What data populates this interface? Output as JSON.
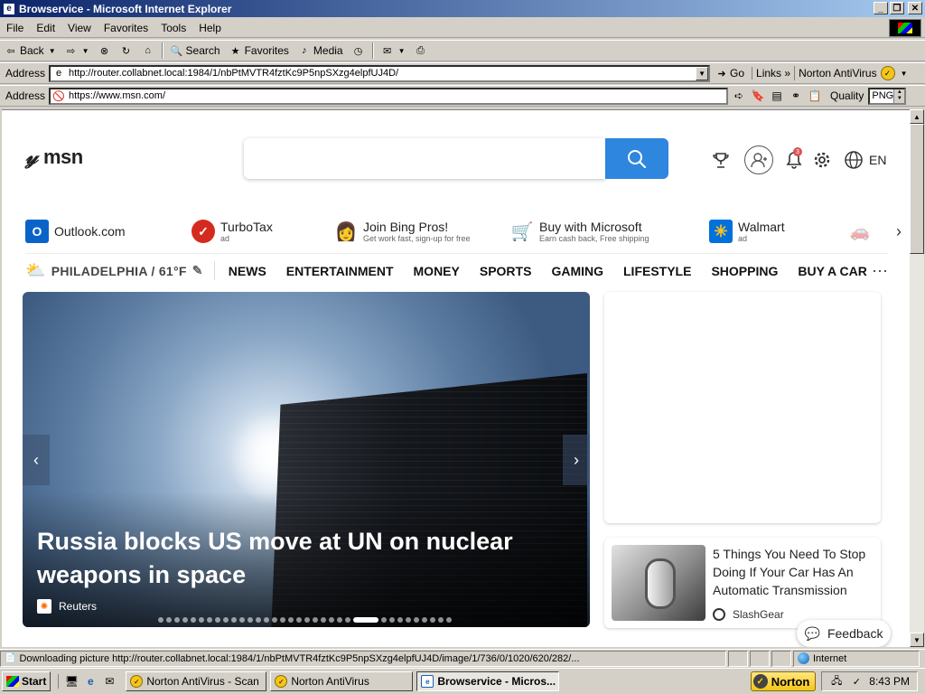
{
  "window": {
    "title": "Browservice - Microsoft Internet Explorer"
  },
  "menubar": {
    "items": [
      "File",
      "Edit",
      "View",
      "Favorites",
      "Tools",
      "Help"
    ]
  },
  "toolbar": {
    "back_label": "Back",
    "search_label": "Search",
    "favorites_label": "Favorites",
    "media_label": "Media"
  },
  "address_bar": {
    "label": "Address",
    "url": "http://router.collabnet.local:1984/1/nbPtMVTR4fztKc9P5npSXzg4elpfUJ4D/",
    "go_label": "Go",
    "links_label": "Links",
    "norton_label": "Norton AntiVirus"
  },
  "browservice_bar": {
    "label": "Address",
    "url": "https://www.msn.com/",
    "quality_label": "Quality",
    "quality_value": "PNG"
  },
  "msn": {
    "logo_text": "msn",
    "search_placeholder": "",
    "notification_count": "3",
    "language": "EN",
    "quicklinks": [
      {
        "title": "Outlook.com",
        "sub": "",
        "icon": "O",
        "color": "#0a64c8"
      },
      {
        "title": "TurboTax",
        "sub": "ad",
        "icon": "✓",
        "color": "#d52b1e"
      },
      {
        "title": "Join Bing Pros!",
        "sub": "Get work fast, sign-up for free",
        "icon": "👩",
        "color": "#ffffff"
      },
      {
        "title": "Buy with Microsoft",
        "sub": "Earn cash back, Free shipping",
        "icon": "🛒",
        "color": "#ffffff"
      },
      {
        "title": "Walmart",
        "sub": "ad",
        "icon": "✳",
        "color": "#0071dc"
      }
    ],
    "weather": "PHILADELPHIA / 61°F",
    "nav": [
      "NEWS",
      "ENTERTAINMENT",
      "MONEY",
      "SPORTS",
      "GAMING",
      "LIFESTYLE",
      "SHOPPING",
      "BUY A CAR"
    ],
    "hero": {
      "headline": "Russia blocks US move at UN on nuclear weapons in space",
      "source": "Reuters",
      "slide_count": 34,
      "active_slide": 24
    },
    "side_card": {
      "title": "5 Things You Need To Stop Doing If Your Car Has An Automatic Transmission",
      "source": "SlashGear"
    },
    "feedback_label": "Feedback"
  },
  "statusbar": {
    "text": "Downloading picture http://router.collabnet.local:1984/1/nbPtMVTR4fztKc9P5npSXzg4elpfUJ4D/image/1/736/0/1020/620/282/...",
    "zone": "Internet"
  },
  "taskbar": {
    "start_label": "Start",
    "tasks": [
      {
        "label": "Norton AntiVirus - Scan",
        "icon": "norton",
        "active": false
      },
      {
        "label": "Norton AntiVirus",
        "icon": "norton",
        "active": false
      },
      {
        "label": "Browservice - Micros...",
        "icon": "ie",
        "active": true
      }
    ],
    "norton_label": "Norton",
    "clock": "8:43 PM"
  },
  "colors": {
    "accent_blue": "#2e86de",
    "titlebar": "#0a246a"
  }
}
